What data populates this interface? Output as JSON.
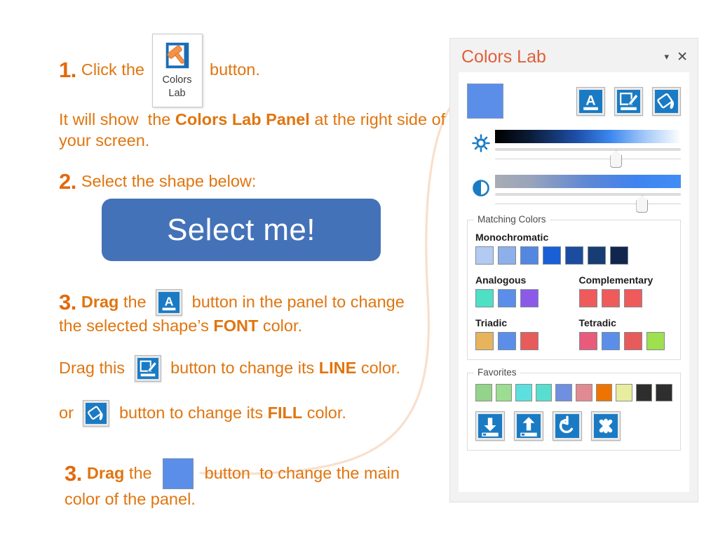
{
  "instructions": {
    "step1": {
      "num": "1.",
      "pre": "Click the ",
      "post": " button.",
      "ribbon_button": {
        "caption_line1": "Colors",
        "caption_line2": "Lab",
        "icon": "hammer-page-icon"
      }
    },
    "step1_note": {
      "pre": "It will show  the ",
      "bold": "Colors Lab Panel",
      "post": " at the right side of",
      "line2": "your screen."
    },
    "step2": {
      "num": "2.",
      "text": "Select the shape below:"
    },
    "shape": {
      "label": "Select me!",
      "fill": "#4472b8",
      "text_color": "#ffffff"
    },
    "step3": {
      "num": "3.",
      "bold_word": "Drag",
      "pre": " the ",
      "mid": " button in the panel to change",
      "line2_pre": "the selected shape’s ",
      "line2_bold": "FONT",
      "line2_post": " color.",
      "icon": "font-color-icon"
    },
    "line_step": {
      "pre": "Drag this ",
      "mid": " button to change its ",
      "bold": "LINE",
      "post": " color.",
      "icon": "line-color-icon"
    },
    "fill_step": {
      "pre": "or ",
      "mid": " button to change its ",
      "bold": "FILL",
      "post": " color.",
      "icon": "fill-color-icon"
    },
    "main_step": {
      "num": "3.",
      "bold_word": "Drag",
      "pre": " the ",
      "mid": " button  to change the main",
      "line2": "color of the panel.",
      "swatch": "#5b8ee8"
    }
  },
  "panel": {
    "title": "Colors Lab",
    "title_color": "#e0603a",
    "caret_icon": "chevron-down-icon",
    "close_icon": "close-icon",
    "main_swatch": "#5b8ee8",
    "tools": [
      {
        "name": "font-color-tool",
        "icon": "font-color-icon"
      },
      {
        "name": "line-color-tool",
        "icon": "line-color-icon"
      },
      {
        "name": "fill-color-tool",
        "icon": "fill-color-icon"
      }
    ],
    "sliders": [
      {
        "name": "brightness",
        "icon": "brightness-sun-icon",
        "thumb_percent": 62
      },
      {
        "name": "contrast",
        "icon": "contrast-half-circle-icon",
        "thumb_percent": 76
      }
    ],
    "matching_colors": {
      "legend": "Matching Colors",
      "monochromatic": {
        "label": "Monochromatic",
        "colors": [
          "#b3cbf2",
          "#8eb0ea",
          "#5487e0",
          "#1a5fd6",
          "#1c4c9e",
          "#183c74",
          "#11264d"
        ]
      },
      "analogous": {
        "label": "Analogous",
        "colors": [
          "#4ee0c4",
          "#5b8ee8",
          "#8b5be8"
        ]
      },
      "complementary": {
        "label": "Complementary",
        "colors": [
          "#ef5b5b",
          "#ef5b5b",
          "#ef5b5b"
        ]
      },
      "triadic": {
        "label": "Triadic",
        "colors": [
          "#e8b45b",
          "#5b8ee8",
          "#e85b5b"
        ]
      },
      "tetradic": {
        "label": "Tetradic",
        "colors": [
          "#e85b7a",
          "#5b8ee8",
          "#e85b5b",
          "#9ee04e"
        ]
      }
    },
    "favorites": {
      "legend": "Favorites",
      "colors": [
        "#94d38b",
        "#9bdd92",
        "#5ddfe0",
        "#57ded0",
        "#6f8fe0",
        "#e08a94",
        "#ef7300",
        "#e8eda0",
        "#2e2e2e",
        "#2e2e2e"
      ],
      "actions": [
        {
          "name": "save-favorites-button",
          "icon": "download-icon"
        },
        {
          "name": "load-favorites-button",
          "icon": "upload-icon"
        },
        {
          "name": "reset-favorites-button",
          "icon": "undo-icon"
        },
        {
          "name": "clear-favorites-button",
          "icon": "clear-x-icon"
        }
      ]
    }
  }
}
